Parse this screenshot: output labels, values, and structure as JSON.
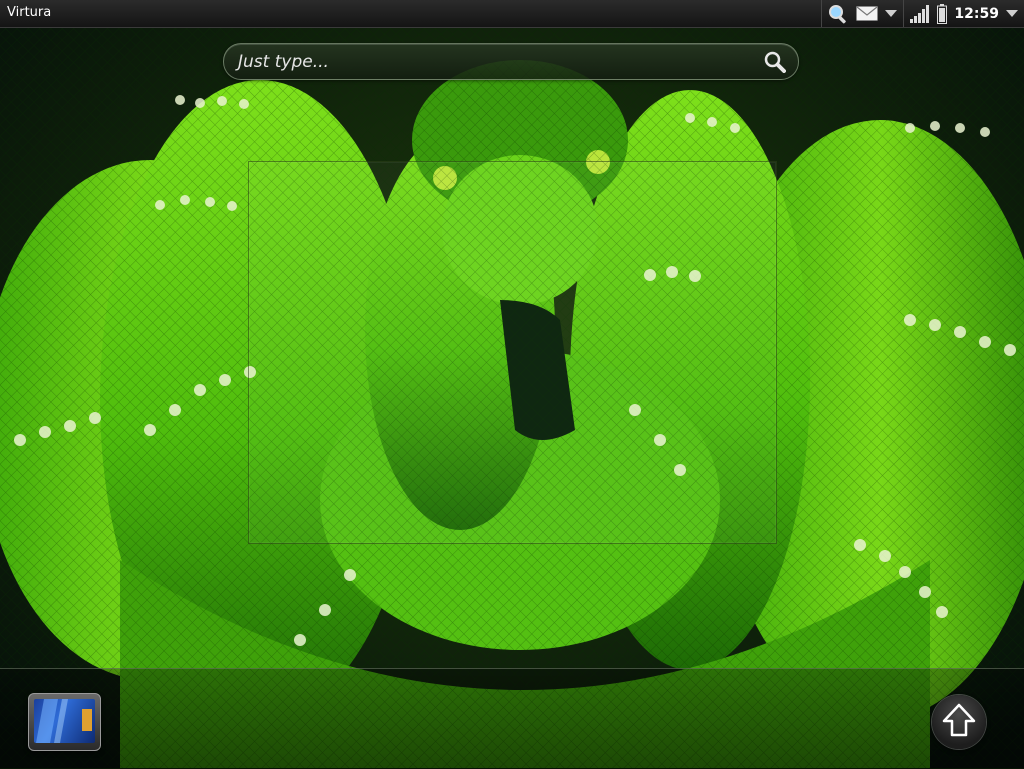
{
  "status_bar": {
    "app_name": "Virtura",
    "time": "12:59",
    "icons": [
      "search-notification-icon",
      "mail-icon",
      "chevron-down-icon",
      "signal-icon",
      "battery-icon",
      "chevron-down-icon"
    ]
  },
  "search": {
    "placeholder": "Just type...",
    "icon": "search-icon"
  },
  "dock": {
    "launcher_icon": "launcher-app-icon",
    "home_icon": "home-arrow-icon"
  },
  "colors": {
    "snake_green": "#5fcf12",
    "dark_background": "#0f2a08",
    "status_bar": "#1c1c1c"
  }
}
